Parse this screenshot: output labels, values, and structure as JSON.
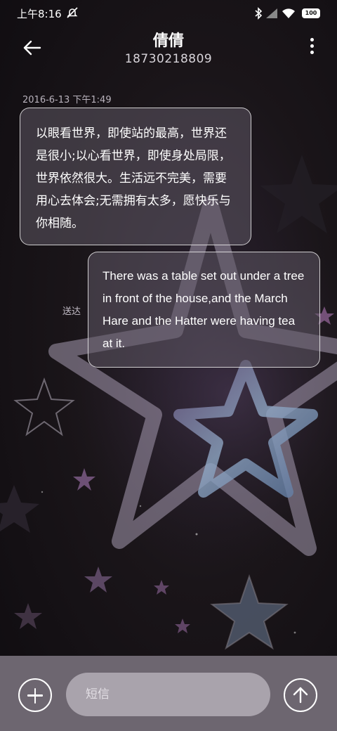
{
  "status_bar": {
    "time": "上午8:16",
    "icons": [
      "mute-icon",
      "bluetooth-icon",
      "signal-icon",
      "wifi-icon",
      "battery-icon"
    ],
    "battery": "100"
  },
  "header": {
    "contact_name": "倩倩",
    "phone_number": "18730218809",
    "back_icon": "arrow-left-icon",
    "more_icon": "more-vertical-icon"
  },
  "conversation": {
    "timestamp": "2016-6-13 下午1:49",
    "incoming_message": "以眼看世界，即使站的最高，世界还是很小;以心看世界，即使身处局限，世界依然很大。生活远不完美，需要用心去体会;无需拥有太多，愿快乐与你相随。",
    "outgoing_message": "There was a table set out under a tree in front of the house,and the March Hare and the Hatter were having tea at it.",
    "outgoing_status": "送达"
  },
  "composer": {
    "placeholder": "短信",
    "add_icon": "plus-circle-icon",
    "send_icon": "arrow-up-circle-icon"
  },
  "theme": {
    "bubble_border": "#ffffff",
    "bottom_bar": "#6d6670",
    "background": "#120f14"
  }
}
